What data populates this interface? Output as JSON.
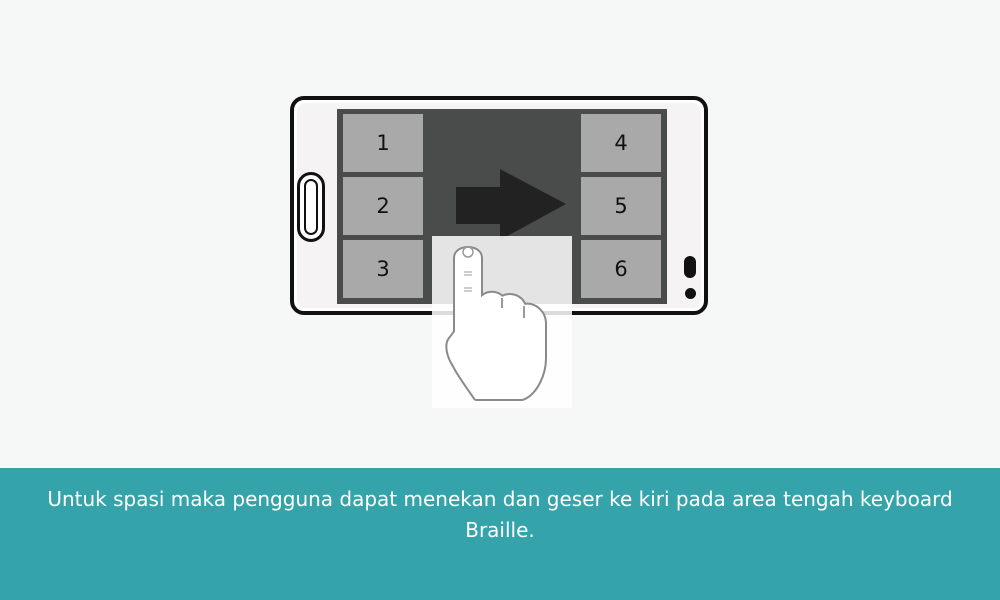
{
  "keyboard": {
    "left_keys": [
      "1",
      "2",
      "3"
    ],
    "right_keys": [
      "4",
      "5",
      "6"
    ]
  },
  "caption": {
    "text": "Untuk spasi maka pengguna dapat menekan dan geser ke kiri pada area tengah keyboard Braille."
  },
  "colors": {
    "background": "#f6f7f7",
    "screen": "#4a4b4b",
    "key": "#a9a9a9",
    "arrow": "#222222",
    "caption_band": "#35a3aa"
  },
  "icons": {
    "gesture_arrow": "right-arrow-icon",
    "gesture_hand": "pointing-hand-icon"
  }
}
